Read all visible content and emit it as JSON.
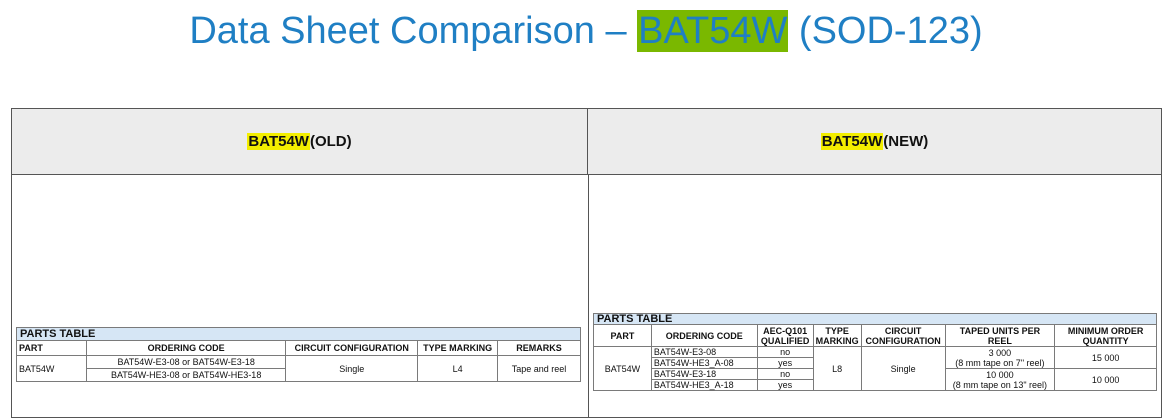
{
  "title": {
    "prefix": "Data Sheet Comparison – ",
    "highlight": "BAT54W",
    "suffix": " (SOD-123)"
  },
  "old": {
    "header_part": "BAT54W",
    "header_tag": " (OLD)",
    "table": {
      "caption": "PARTS TABLE",
      "columns": [
        "PART",
        "ORDERING CODE",
        "CIRCUIT CONFIGURATION",
        "TYPE MARKING",
        "REMARKS"
      ],
      "part": "BAT54W",
      "codes": [
        "BAT54W-E3-08 or BAT54W-E3-18",
        "BAT54W-HE3-08 or BAT54W-HE3-18"
      ],
      "circuit": "Single",
      "marking": "L4",
      "remarks": "Tape and reel"
    }
  },
  "new": {
    "header_part": "BAT54W",
    "header_tag": " (NEW)",
    "table": {
      "caption": "PARTS TABLE",
      "columns": [
        "PART",
        "ORDERING CODE",
        "AEC-Q101 QUALIFIED",
        "TYPE MARKING",
        "CIRCUIT CONFIGURATION",
        "TAPED UNITS PER REEL",
        "MINIMUM ORDER QUANTITY"
      ],
      "part": "BAT54W",
      "rows": [
        {
          "code": "BAT54W-E3-08",
          "qualified": "no"
        },
        {
          "code": "BAT54W-HE3_A-08",
          "qualified": "yes"
        },
        {
          "code": "BAT54W-E3-18",
          "qualified": "no"
        },
        {
          "code": "BAT54W-HE3_A-18",
          "qualified": "yes"
        }
      ],
      "marking": "L8",
      "circuit": "Single",
      "reel_1": "3 000",
      "reel_1_note": "(8 mm tape on 7\" reel)",
      "moq_1": "15 000",
      "reel_2": "10 000",
      "reel_2_note": "(8 mm tape on 13\" reel)",
      "moq_2": "10 000"
    }
  }
}
